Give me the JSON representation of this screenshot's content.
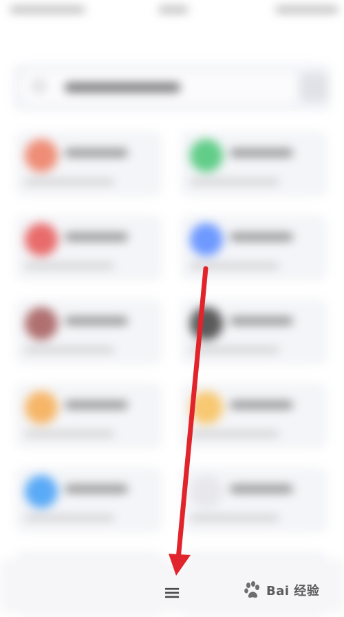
{
  "search": {
    "icon": "search-icon"
  },
  "tiles": [
    {
      "icon": "app-icon",
      "color": "#ef8d76"
    },
    {
      "icon": "app-icon",
      "color": "#61cd88"
    },
    {
      "icon": "app-icon",
      "color": "#e96b6b"
    },
    {
      "icon": "app-icon",
      "color": "#6e99ff"
    },
    {
      "icon": "app-icon",
      "color": "#b07070"
    },
    {
      "icon": "app-icon",
      "color": "#5a5a5a"
    },
    {
      "icon": "app-icon",
      "color": "#f6b668"
    },
    {
      "icon": "app-icon",
      "color": "#f8c872"
    },
    {
      "icon": "app-icon",
      "color": "#5aaaf7"
    },
    {
      "icon": "app-icon",
      "color": "#e8e8ec"
    },
    {
      "icon": "app-icon",
      "color": "#777777"
    },
    {
      "icon": "app-icon",
      "color": "#83cf83"
    }
  ],
  "bottom_bar": {
    "menu_icon": "≡",
    "menu_icon_name": "hamburger-menu-icon"
  },
  "annotation": {
    "arrow_color": "#e1242b"
  },
  "watermark": {
    "text": "Bai 经验",
    "icon": "baidu-paw-icon"
  }
}
